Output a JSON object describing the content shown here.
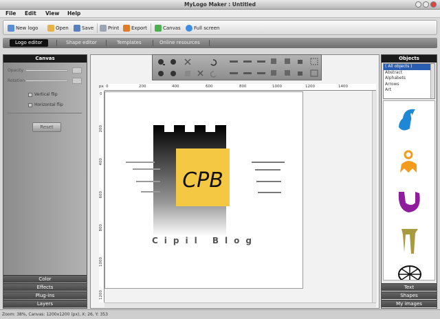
{
  "window": {
    "title": "MyLogo Maker : Untitled"
  },
  "menu": [
    "File",
    "Edit",
    "View",
    "Help"
  ],
  "toolbar": {
    "new_logo": "New logo",
    "open": "Open",
    "save": "Save",
    "print": "Print",
    "export": "Export",
    "canvas": "Canvas",
    "full_screen": "Full screen"
  },
  "tabs": [
    "Logo editor",
    "Shape editor",
    "Templates",
    "Online resources"
  ],
  "left_panel": {
    "header": "Canvas",
    "opacity_label": "Opacity",
    "rotation_label": "Rotation",
    "vertical_flip": "Vertical flip",
    "horizontal_flip": "Horizontal flip",
    "reset": "Reset",
    "sections": [
      "Color",
      "Effects",
      "Plug-ins",
      "Layers"
    ]
  },
  "ruler": {
    "h_ticks": [
      "0",
      "200",
      "400",
      "600",
      "800",
      "1000",
      "1200",
      "1400"
    ],
    "v_ticks": [
      "0",
      "200",
      "400",
      "600",
      "800",
      "1000",
      "1200"
    ],
    "unit": "px"
  },
  "logo": {
    "initials": "CPB",
    "tagline": "Cipil Blog"
  },
  "right_panel": {
    "header": "Objects",
    "objects": [
      "( All objects )",
      "Abstract",
      "Alphabets",
      "Arrows",
      "Art"
    ],
    "thumb_icons": [
      "blue-swoosh-icon",
      "orange-figure-icon",
      "purple-shape-icon",
      "olive-glass-icon",
      "globe-icon"
    ],
    "sections": [
      "Text",
      "Shapes",
      "My images"
    ]
  },
  "status": "Zoom: 38%, Canvas: 1200x1200 (px), X: 26, Y: 353",
  "colors": {
    "accent": "#f4c842",
    "dark": "#111111",
    "selected": "#2a5db0"
  }
}
